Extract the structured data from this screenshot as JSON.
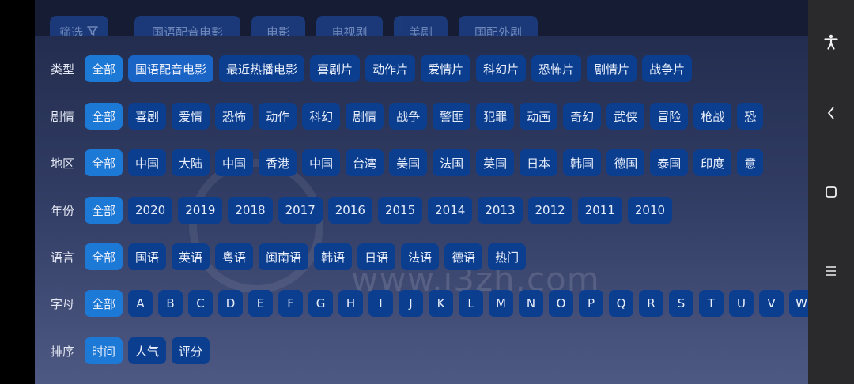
{
  "topbar": {
    "filter_label": "筛选",
    "tabs": [
      "国语配音电影",
      "电影",
      "电视剧",
      "美剧",
      "国配外剧"
    ]
  },
  "rows": [
    {
      "label": "类型",
      "active": 0,
      "selected": 1,
      "items": [
        "全部",
        "国语配音电影",
        "最近热播电影",
        "喜剧片",
        "动作片",
        "爱情片",
        "科幻片",
        "恐怖片",
        "剧情片",
        "战争片"
      ]
    },
    {
      "label": "剧情",
      "active": 0,
      "items": [
        "全部",
        "喜剧",
        "爱情",
        "恐怖",
        "动作",
        "科幻",
        "剧情",
        "战争",
        "警匪",
        "犯罪",
        "动画",
        "奇幻",
        "武侠",
        "冒险",
        "枪战",
        "恐"
      ]
    },
    {
      "label": "地区",
      "active": 0,
      "items": [
        "全部",
        "中国",
        "大陆",
        "中国",
        "香港",
        "中国",
        "台湾",
        "美国",
        "法国",
        "英国",
        "日本",
        "韩国",
        "德国",
        "泰国",
        "印度",
        "意"
      ]
    },
    {
      "label": "年份",
      "active": 0,
      "items": [
        "全部",
        "2020",
        "2019",
        "2018",
        "2017",
        "2016",
        "2015",
        "2014",
        "2013",
        "2012",
        "2011",
        "2010"
      ]
    },
    {
      "label": "语言",
      "active": 0,
      "items": [
        "全部",
        "国语",
        "英语",
        "粤语",
        "闽南语",
        "韩语",
        "日语",
        "法语",
        "德语",
        "热门"
      ]
    },
    {
      "label": "字母",
      "active": 0,
      "letters": true,
      "items": [
        "全部",
        "A",
        "B",
        "C",
        "D",
        "E",
        "F",
        "G",
        "H",
        "I",
        "J",
        "K",
        "L",
        "M",
        "N",
        "O",
        "P",
        "Q",
        "R",
        "S",
        "T",
        "U",
        "V",
        "W"
      ]
    },
    {
      "label": "排序",
      "active": 0,
      "items": [
        "时间",
        "人气",
        "评分"
      ]
    }
  ],
  "watermark": "www.i3zh.com",
  "colors": {
    "chip": "#0b3e8f",
    "chip_active": "#1d79d6",
    "panel": "#2a3459"
  },
  "navbar_icons": [
    "accessibility-icon",
    "back-icon",
    "home-icon",
    "menu-icon"
  ]
}
